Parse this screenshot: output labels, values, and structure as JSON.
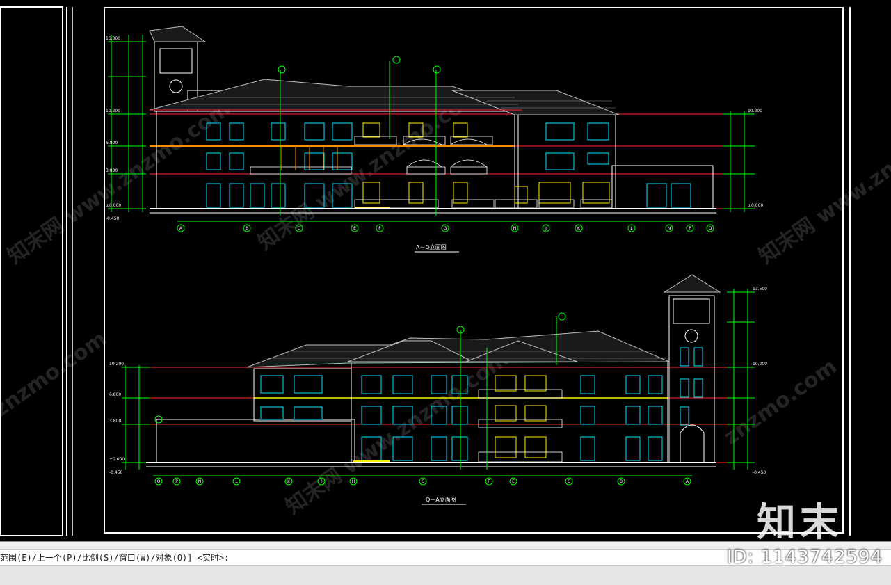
{
  "drawing": {
    "elevation_top_title": "A－Q立面图",
    "elevation_bottom_title": "Q－A立面图",
    "elevation_top_levels": [
      "10.200",
      "6.800",
      "3.800",
      "±0.000",
      "-0.450"
    ],
    "elevation_bottom_levels": [
      "10.200",
      "6.800",
      "3.800",
      "±0.000",
      "-0.450"
    ],
    "elevation_top_axes": [
      "A",
      "B",
      "C",
      "E",
      "F",
      "G",
      "H",
      "J",
      "K",
      "L",
      "N",
      "P",
      "Q"
    ],
    "elevation_bottom_axes": [
      "Q",
      "P",
      "N",
      "L",
      "K",
      "J",
      "H",
      "G",
      "F",
      "E",
      "C",
      "B",
      "A"
    ],
    "tower_top_level": "16.300",
    "ridge_level": "13.500"
  },
  "command_line": {
    "prompt": "范围(E)/上一个(P)/比例(S)/窗口(W)/对象(O)] <实时>:"
  },
  "watermark": {
    "id_text": "ID: 1143742594",
    "logo_text": "知末",
    "site_text": "znzmo.com",
    "cn_text": "知末网 www.znzmo.com"
  },
  "colors": {
    "frame": "#ffffff",
    "dim_lines": "#00ff00",
    "level_lines": "#ff2a2a",
    "roof": "#c0c0c0",
    "windows": "#00e5ff",
    "yellow": "#ffee00"
  }
}
